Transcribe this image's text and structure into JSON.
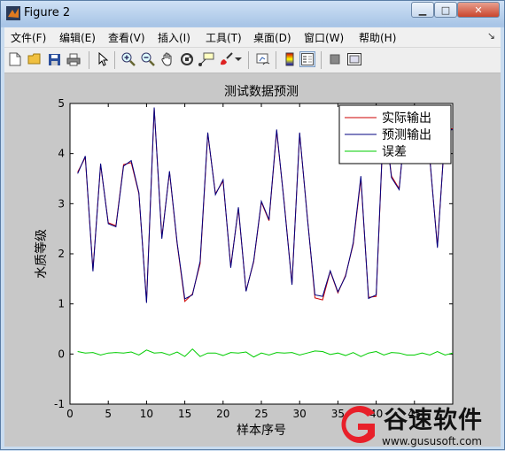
{
  "window": {
    "title": "Figure 2",
    "buttons": {
      "minimize": "▁",
      "maximize": "□",
      "close": "✕"
    }
  },
  "menu": [
    "文件(F)",
    "编辑(E)",
    "查看(V)",
    "插入(I)",
    "工具(T)",
    "桌面(D)",
    "窗口(W)",
    "帮助(H)"
  ],
  "menu_arrow": "↘",
  "toolbar": [
    "new-file-icon",
    "open-folder-icon",
    "save-icon",
    "print-icon",
    "pointer-icon",
    "zoom-in-icon",
    "zoom-out-icon",
    "pan-hand-icon",
    "rotate-3d-icon",
    "data-cursor-icon",
    "brush-icon",
    "link-plot-icon",
    "colorbar-icon",
    "legend-icon",
    "hide-plot-tools-icon",
    "show-plot-tools-icon"
  ],
  "watermark": {
    "brand": "谷速软件",
    "url": "www.gususoft.com",
    "accent": "#e8202a"
  },
  "chart_data": {
    "type": "line",
    "title": "测试数据预测",
    "xlabel": "样本序号",
    "ylabel": "水质等级",
    "xlim": [
      0,
      50
    ],
    "ylim": [
      -1,
      5
    ],
    "xticks": [
      0,
      5,
      10,
      15,
      20,
      25,
      30,
      35,
      40,
      45
    ],
    "yticks": [
      -1,
      0,
      1,
      2,
      3,
      4,
      5
    ],
    "legend_position": "top-right",
    "grid": false,
    "x": [
      1,
      2,
      3,
      4,
      5,
      6,
      7,
      8,
      9,
      10,
      11,
      12,
      13,
      14,
      15,
      16,
      17,
      18,
      19,
      20,
      21,
      22,
      23,
      24,
      25,
      26,
      27,
      28,
      29,
      30,
      31,
      32,
      33,
      34,
      35,
      36,
      37,
      38,
      39,
      40,
      41,
      42,
      43,
      44,
      45,
      46,
      47,
      48,
      49,
      50
    ],
    "series": [
      {
        "name": "实际输出",
        "color": "#cc0000",
        "values": [
          3.63,
          3.92,
          1.68,
          3.78,
          2.62,
          2.56,
          3.78,
          3.82,
          3.2,
          1.05,
          4.9,
          2.33,
          3.63,
          2.2,
          1.05,
          1.2,
          1.8,
          4.4,
          3.2,
          3.45,
          1.75,
          2.9,
          1.26,
          1.84,
          3.03,
          2.66,
          4.45,
          3.0,
          1.4,
          4.4,
          2.75,
          1.12,
          1.08,
          1.65,
          1.22,
          1.57,
          2.19,
          3.5,
          1.13,
          1.15,
          4.8,
          3.55,
          3.3,
          4.9,
          4.4,
          4.55,
          3.9,
          2.15,
          4.45,
          4.5
        ]
      },
      {
        "name": "预测输出",
        "color": "#000080",
        "values": [
          3.6,
          3.95,
          1.65,
          3.8,
          2.6,
          2.54,
          3.75,
          3.86,
          3.22,
          1.02,
          4.92,
          2.3,
          3.65,
          2.22,
          1.1,
          1.18,
          1.85,
          4.42,
          3.18,
          3.48,
          1.72,
          2.93,
          1.25,
          1.86,
          3.05,
          2.68,
          4.48,
          2.98,
          1.38,
          4.42,
          2.73,
          1.18,
          1.15,
          1.66,
          1.24,
          1.55,
          2.22,
          3.55,
          1.11,
          1.18,
          4.82,
          3.52,
          3.28,
          4.92,
          4.42,
          4.5,
          3.92,
          2.12,
          4.45,
          4.48
        ]
      },
      {
        "name": "误差",
        "color": "#00cc00",
        "values": [
          0.05,
          0.02,
          0.03,
          -0.02,
          0.02,
          0.03,
          0.02,
          0.04,
          -0.02,
          0.08,
          0.02,
          0.03,
          -0.02,
          0.04,
          -0.05,
          0.1,
          -0.05,
          0.02,
          0.02,
          -0.03,
          0.03,
          0.02,
          0.04,
          -0.06,
          0.02,
          -0.02,
          0.03,
          0.02,
          0.03,
          -0.02,
          0.02,
          0.06,
          0.05,
          -0.01,
          0.02,
          -0.03,
          0.03,
          -0.05,
          0.02,
          0.05,
          -0.02,
          0.03,
          0.02,
          -0.02,
          -0.02,
          0.02,
          -0.02,
          0.05,
          -0.02,
          0.02
        ]
      }
    ]
  }
}
